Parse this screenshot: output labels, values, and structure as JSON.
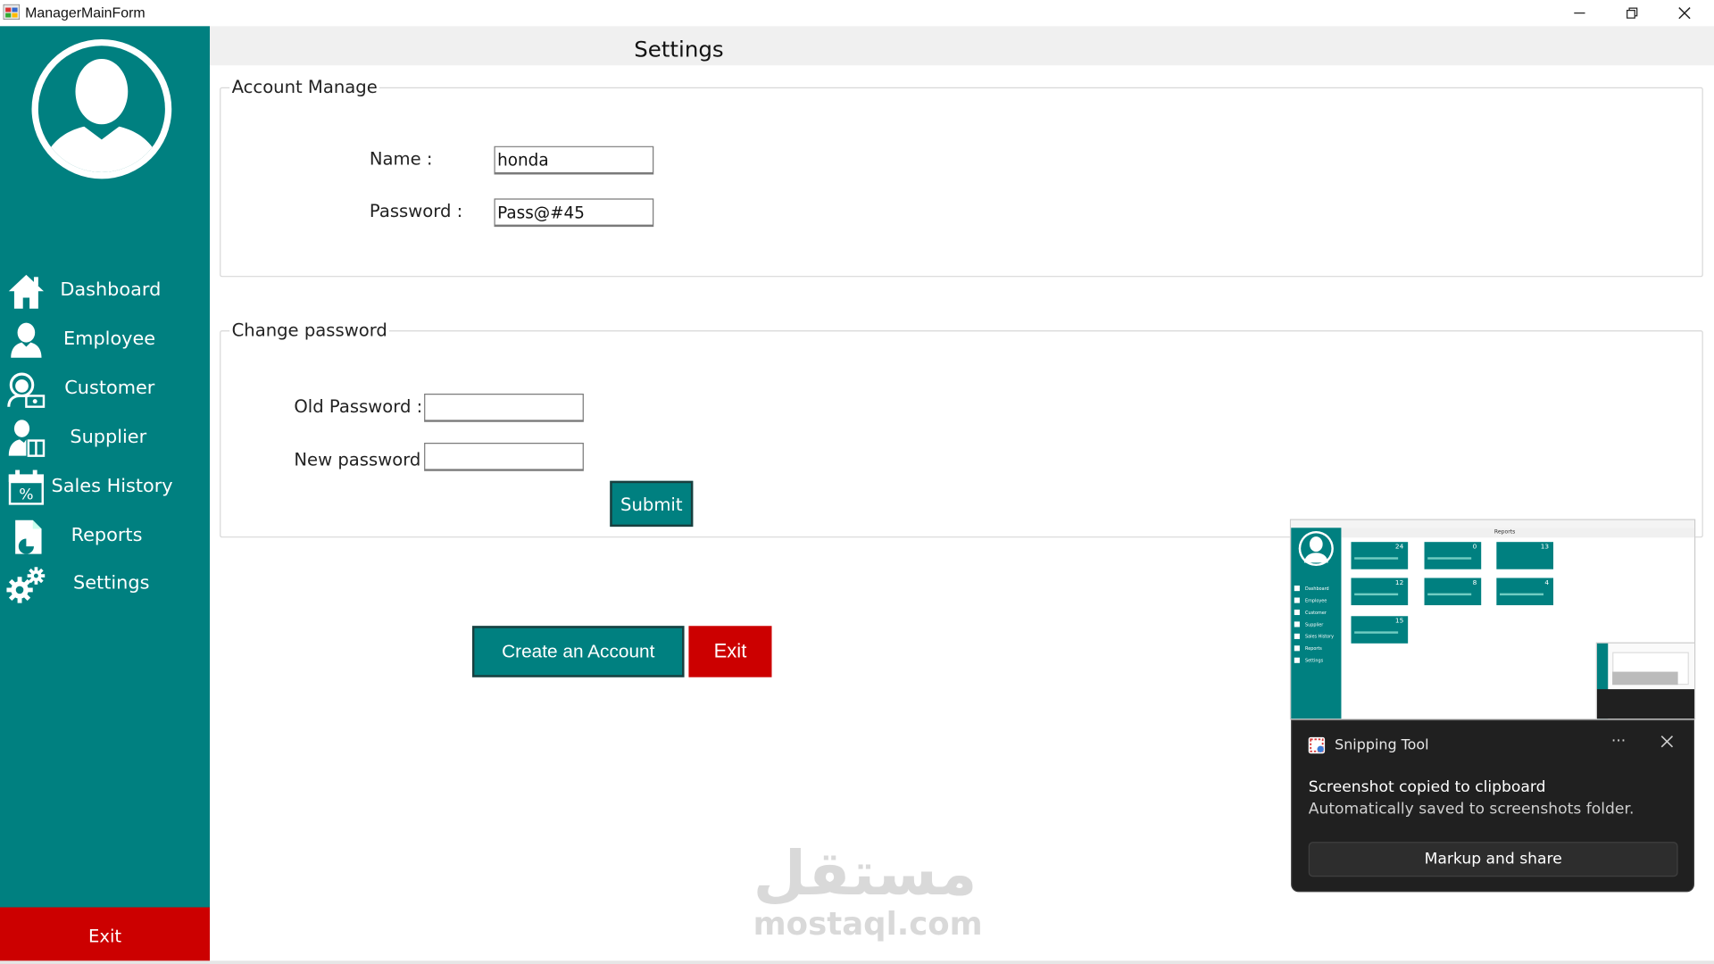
{
  "window": {
    "title": "ManagerMainForm",
    "controls": {
      "minimize": "—",
      "restore": "❐",
      "close": "✕"
    }
  },
  "colors": {
    "sidebar": "#008080",
    "danger": "#cc0000",
    "toast_bg": "#202020"
  },
  "sidebar": {
    "items": [
      {
        "label": "Dashboard",
        "icon": "home-icon"
      },
      {
        "label": "Employee",
        "icon": "user-icon"
      },
      {
        "label": "Customer",
        "icon": "customer-icon"
      },
      {
        "label": "Supplier",
        "icon": "supplier-icon"
      },
      {
        "label": "Sales History",
        "icon": "calendar-percent-icon"
      },
      {
        "label": "Reports",
        "icon": "report-icon"
      },
      {
        "label": "Settings",
        "icon": "gears-icon"
      }
    ],
    "exit_label": "Exit"
  },
  "header": {
    "title": "Settings"
  },
  "account_manage": {
    "legend": "Account Manage",
    "name_label": "Name :",
    "name_value": "honda",
    "password_label": "Password :",
    "password_value": "Pass@#45"
  },
  "change_password": {
    "legend": "Change password",
    "old_label": "Old Password :",
    "old_value": "",
    "new_label": "New password :",
    "new_value": "",
    "submit_label": "Submit"
  },
  "actions": {
    "create_label": "Create an Account",
    "exit_label": "Exit"
  },
  "watermark": {
    "arabic": "مستقل",
    "latin": "mostaql.com"
  },
  "thumbnail": {
    "header_title": "Reports",
    "nav": [
      "Dashboard",
      "Employee",
      "Customer",
      "Supplier",
      "Sales History",
      "Reports",
      "Settings"
    ],
    "cards": [
      {
        "value": "24"
      },
      {
        "value": "0"
      },
      {
        "value": "13"
      },
      {
        "value": "12"
      },
      {
        "value": "8"
      },
      {
        "value": "4"
      },
      {
        "value": "15"
      }
    ]
  },
  "toast": {
    "app_name": "Snipping Tool",
    "more": "···",
    "title": "Screenshot copied to clipboard",
    "body": "Automatically saved to screenshots folder.",
    "button_label": "Markup and share"
  }
}
